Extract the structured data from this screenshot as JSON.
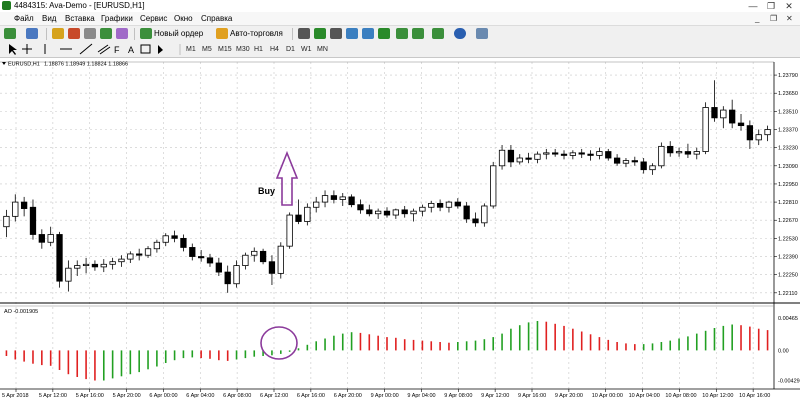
{
  "window": {
    "title": "4484315: Ava-Demo - [EURUSD,H1]",
    "minimize_glyph": "—",
    "restore_glyph": "❐",
    "close_glyph": "✕"
  },
  "menu": {
    "items": [
      "Файл",
      "Вид",
      "Вставка",
      "Графики",
      "Сервис",
      "Окно",
      "Справка"
    ]
  },
  "toolbar": {
    "new_order_label": "Новый ордер",
    "auto_trading_label": "Авто-торговля",
    "icons": [
      "new-chart-icon",
      "profiles-icon",
      "market-watch-icon",
      "navigator-icon",
      "data-window-icon",
      "terminal-icon",
      "strategy-tester-icon",
      "new-order-icon",
      "auto-trading-icon",
      "bar-chart-icon",
      "candlestick-icon",
      "line-chart-icon",
      "zoom-in-icon",
      "zoom-out-icon",
      "tile-windows-icon",
      "autoscroll-icon",
      "chart-shift-icon",
      "indicators-icon",
      "periods-icon",
      "templates-icon"
    ]
  },
  "drawing_tools": {
    "icons": [
      "cursor-icon",
      "crosshair-icon",
      "vertical-line-icon",
      "horizontal-line-icon",
      "trendline-icon",
      "equidistant-channel-icon",
      "fibonacci-icon",
      "text-icon",
      "text-label-icon",
      "arrows-icon"
    ]
  },
  "timeframes": [
    "M1",
    "M5",
    "M15",
    "M30",
    "H1",
    "H4",
    "D1",
    "W1",
    "MN"
  ],
  "chart_data": {
    "type": "candlestick",
    "symbol_label": "EURUSD,H1",
    "ohlc_header": "1.18876 1.18949 1.18824 1.18866",
    "price_ticks": [
      "1.23790",
      "1.23650",
      "1.23510",
      "1.23370",
      "1.23230",
      "1.23090",
      "1.22950",
      "1.22810",
      "1.22670",
      "1.22530",
      "1.22390",
      "1.22250",
      "1.22110"
    ],
    "price_range": [
      1.2207,
      1.2386
    ],
    "time_labels": [
      "5 Apr 2018",
      "5 Apr 12:00",
      "5 Apr 16:00",
      "5 Apr 20:00",
      "6 Apr 00:00",
      "6 Apr 04:00",
      "6 Apr 08:00",
      "6 Apr 12:00",
      "6 Apr 16:00",
      "6 Apr 20:00",
      "9 Apr 00:00",
      "9 Apr 04:00",
      "9 Apr 08:00",
      "9 Apr 12:00",
      "9 Apr 16:00",
      "9 Apr 20:00",
      "10 Apr 00:00",
      "10 Apr 04:00",
      "10 Apr 08:00",
      "10 Apr 12:00",
      "10 Apr 16:00"
    ],
    "annotation": "Buy",
    "up_color": "#ffffff",
    "down_color": "#000000",
    "candles": [
      [
        1.2262,
        1.2275,
        1.2254,
        1.227
      ],
      [
        1.227,
        1.2287,
        1.2266,
        1.2281
      ],
      [
        1.2281,
        1.2285,
        1.227,
        1.2276
      ],
      [
        1.2277,
        1.2283,
        1.2252,
        1.2256
      ],
      [
        1.2256,
        1.226,
        1.2245,
        1.225
      ],
      [
        1.225,
        1.2262,
        1.2247,
        1.2256
      ],
      [
        1.2256,
        1.2258,
        1.2215,
        1.222
      ],
      [
        1.222,
        1.2236,
        1.2212,
        1.223
      ],
      [
        1.223,
        1.2236,
        1.2224,
        1.2232
      ],
      [
        1.2232,
        1.2238,
        1.2226,
        1.2233
      ],
      [
        1.2233,
        1.2236,
        1.2228,
        1.2231
      ],
      [
        1.2231,
        1.2237,
        1.2227,
        1.2233
      ],
      [
        1.2233,
        1.2238,
        1.2229,
        1.2235
      ],
      [
        1.2235,
        1.224,
        1.2231,
        1.2237
      ],
      [
        1.2237,
        1.2243,
        1.2234,
        1.2241
      ],
      [
        1.2241,
        1.2245,
        1.2236,
        1.224
      ],
      [
        1.224,
        1.2247,
        1.2238,
        1.2245
      ],
      [
        1.2245,
        1.2252,
        1.2242,
        1.225
      ],
      [
        1.225,
        1.2257,
        1.2247,
        1.2255
      ],
      [
        1.2255,
        1.2259,
        1.225,
        1.2253
      ],
      [
        1.2253,
        1.2256,
        1.2243,
        1.2246
      ],
      [
        1.2246,
        1.2249,
        1.2236,
        1.2239
      ],
      [
        1.2239,
        1.2244,
        1.2235,
        1.2238
      ],
      [
        1.2238,
        1.2241,
        1.2231,
        1.2234
      ],
      [
        1.2234,
        1.2238,
        1.2224,
        1.2227
      ],
      [
        1.2227,
        1.2232,
        1.2211,
        1.2218
      ],
      [
        1.2218,
        1.2236,
        1.2215,
        1.2232
      ],
      [
        1.2232,
        1.2242,
        1.2229,
        1.224
      ],
      [
        1.224,
        1.2246,
        1.2235,
        1.2243
      ],
      [
        1.2243,
        1.2245,
        1.2233,
        1.2235
      ],
      [
        1.2235,
        1.224,
        1.2217,
        1.2226
      ],
      [
        1.2226,
        1.225,
        1.2222,
        1.2247
      ],
      [
        1.2247,
        1.2273,
        1.2245,
        1.2271
      ],
      [
        1.2271,
        1.2283,
        1.2264,
        1.2266
      ],
      [
        1.2266,
        1.228,
        1.2263,
        1.2277
      ],
      [
        1.2277,
        1.2285,
        1.2273,
        1.2281
      ],
      [
        1.2281,
        1.229,
        1.2277,
        1.2286
      ],
      [
        1.2286,
        1.229,
        1.228,
        1.2283
      ],
      [
        1.2283,
        1.2288,
        1.2278,
        1.2285
      ],
      [
        1.2285,
        1.2287,
        1.2277,
        1.2279
      ],
      [
        1.2279,
        1.2283,
        1.2272,
        1.2275
      ],
      [
        1.2275,
        1.2279,
        1.227,
        1.2272
      ],
      [
        1.2272,
        1.2276,
        1.2268,
        1.2274
      ],
      [
        1.2274,
        1.2277,
        1.2269,
        1.2271
      ],
      [
        1.2271,
        1.2276,
        1.2268,
        1.2275
      ],
      [
        1.2275,
        1.2278,
        1.2269,
        1.2272
      ],
      [
        1.2272,
        1.2276,
        1.2266,
        1.2274
      ],
      [
        1.2274,
        1.2279,
        1.227,
        1.2277
      ],
      [
        1.2277,
        1.2282,
        1.2273,
        1.228
      ],
      [
        1.228,
        1.2283,
        1.2274,
        1.2277
      ],
      [
        1.2277,
        1.2282,
        1.2273,
        1.2281
      ],
      [
        1.2281,
        1.2284,
        1.2276,
        1.2278
      ],
      [
        1.2278,
        1.2281,
        1.2265,
        1.2268
      ],
      [
        1.2268,
        1.2273,
        1.2262,
        1.2265
      ],
      [
        1.2265,
        1.228,
        1.2262,
        1.2278
      ],
      [
        1.2278,
        1.2312,
        1.2276,
        1.2309
      ],
      [
        1.2309,
        1.2325,
        1.2306,
        1.2321
      ],
      [
        1.2321,
        1.2325,
        1.2308,
        1.2312
      ],
      [
        1.2312,
        1.2318,
        1.231,
        1.2315
      ],
      [
        1.2315,
        1.2319,
        1.2311,
        1.2314
      ],
      [
        1.2314,
        1.232,
        1.2311,
        1.2318
      ],
      [
        1.2318,
        1.2322,
        1.2314,
        1.2319
      ],
      [
        1.2319,
        1.2322,
        1.2316,
        1.2318
      ],
      [
        1.2318,
        1.2321,
        1.2314,
        1.2317
      ],
      [
        1.2317,
        1.2321,
        1.2314,
        1.2319
      ],
      [
        1.2319,
        1.2322,
        1.2315,
        1.2318
      ],
      [
        1.2318,
        1.2321,
        1.2313,
        1.2317
      ],
      [
        1.2317,
        1.2323,
        1.2314,
        1.232
      ],
      [
        1.232,
        1.2322,
        1.2313,
        1.2315
      ],
      [
        1.2315,
        1.2318,
        1.2309,
        1.2311
      ],
      [
        1.2311,
        1.2315,
        1.2308,
        1.2313
      ],
      [
        1.2313,
        1.2316,
        1.2309,
        1.2312
      ],
      [
        1.2312,
        1.2315,
        1.2303,
        1.2306
      ],
      [
        1.2306,
        1.2311,
        1.2302,
        1.2309
      ],
      [
        1.2309,
        1.2327,
        1.2307,
        1.2324
      ],
      [
        1.2324,
        1.2328,
        1.2316,
        1.2319
      ],
      [
        1.2319,
        1.2323,
        1.2316,
        1.232
      ],
      [
        1.232,
        1.2326,
        1.2315,
        1.2318
      ],
      [
        1.2318,
        1.2323,
        1.2314,
        1.232
      ],
      [
        1.232,
        1.2358,
        1.2318,
        1.2354
      ],
      [
        1.2354,
        1.2375,
        1.2343,
        1.2346
      ],
      [
        1.2346,
        1.2355,
        1.2338,
        1.2352
      ],
      [
        1.2352,
        1.236,
        1.2338,
        1.2342
      ],
      [
        1.2342,
        1.2349,
        1.2336,
        1.234
      ],
      [
        1.234,
        1.2344,
        1.2322,
        1.2329
      ],
      [
        1.2329,
        1.2337,
        1.2325,
        1.2333
      ],
      [
        1.2333,
        1.234,
        1.2328,
        1.2337
      ]
    ],
    "indicator": {
      "label": "AO -0.001905",
      "ticks": [
        "0.00465",
        "0.00",
        "-0.004294"
      ],
      "range": [
        -0.0048,
        0.0052
      ],
      "up_color": "#22a022",
      "down_color": "#e02020",
      "values": [
        -0.0008,
        -0.0013,
        -0.0016,
        -0.0019,
        -0.0021,
        -0.0022,
        -0.0028,
        -0.0034,
        -0.0038,
        -0.0041,
        -0.0043,
        -0.0043,
        -0.004,
        -0.0037,
        -0.0034,
        -0.0031,
        -0.0027,
        -0.0023,
        -0.0018,
        -0.0014,
        -0.0011,
        -0.001,
        -0.0011,
        -0.0012,
        -0.0014,
        -0.0015,
        -0.0013,
        -0.0011,
        -0.0009,
        -0.0008,
        -0.0007,
        -0.0005,
        -0.0002,
        0.0003,
        0.0008,
        0.0013,
        0.0017,
        0.0021,
        0.0024,
        0.0026,
        0.0025,
        0.0023,
        0.0021,
        0.0019,
        0.0018,
        0.0016,
        0.0015,
        0.0014,
        0.0013,
        0.0012,
        0.0011,
        0.0012,
        0.0013,
        0.0014,
        0.0016,
        0.0019,
        0.0024,
        0.0031,
        0.0036,
        0.004,
        0.0042,
        0.0041,
        0.0038,
        0.0035,
        0.0031,
        0.0027,
        0.0023,
        0.0019,
        0.0015,
        0.0012,
        0.001,
        0.0009,
        0.0009,
        0.001,
        0.0012,
        0.0014,
        0.0017,
        0.002,
        0.0024,
        0.0028,
        0.0032,
        0.0035,
        0.0037,
        0.0036,
        0.0034,
        0.0031,
        0.0029
      ]
    }
  }
}
